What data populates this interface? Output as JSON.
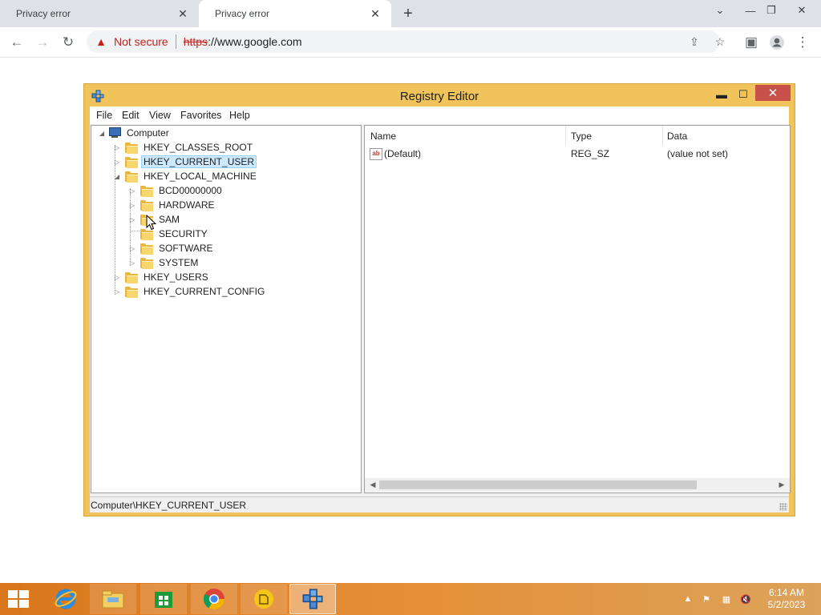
{
  "browser": {
    "tabs": [
      {
        "title": "Privacy error"
      },
      {
        "title": "Privacy error"
      }
    ],
    "security_label": "Not secure",
    "url_scheme": "https",
    "url_rest": "://www.google.com"
  },
  "regedit": {
    "title": "Registry Editor",
    "menu": [
      "File",
      "Edit",
      "View",
      "Favorites",
      "Help"
    ],
    "tree": {
      "root": "Computer",
      "items": [
        {
          "label": "HKEY_CLASSES_ROOT"
        },
        {
          "label": "HKEY_CURRENT_USER",
          "selected": true
        },
        {
          "label": "HKEY_LOCAL_MACHINE",
          "expanded": true
        },
        {
          "label": "BCD00000000"
        },
        {
          "label": "HARDWARE"
        },
        {
          "label": "SAM"
        },
        {
          "label": "SECURITY"
        },
        {
          "label": "SOFTWARE"
        },
        {
          "label": "SYSTEM"
        },
        {
          "label": "HKEY_USERS"
        },
        {
          "label": "HKEY_CURRENT_CONFIG"
        }
      ]
    },
    "columns": [
      "Name",
      "Type",
      "Data"
    ],
    "values": [
      {
        "name": "(Default)",
        "type": "REG_SZ",
        "data": "(value not set)"
      }
    ],
    "status": "Computer\\HKEY_CURRENT_USER"
  },
  "taskbar": {
    "apps": [
      "internet-explorer-icon",
      "file-explorer-icon",
      "store-icon",
      "chrome-icon",
      "files-icon",
      "regedit-icon"
    ],
    "time": "6:14 AM",
    "date": "5/2/2023"
  },
  "colors": {
    "window_frame": "#f0c45a",
    "close_button": "#c7504a",
    "taskbar": "#e58f37",
    "not_secure": "#c5221f"
  }
}
